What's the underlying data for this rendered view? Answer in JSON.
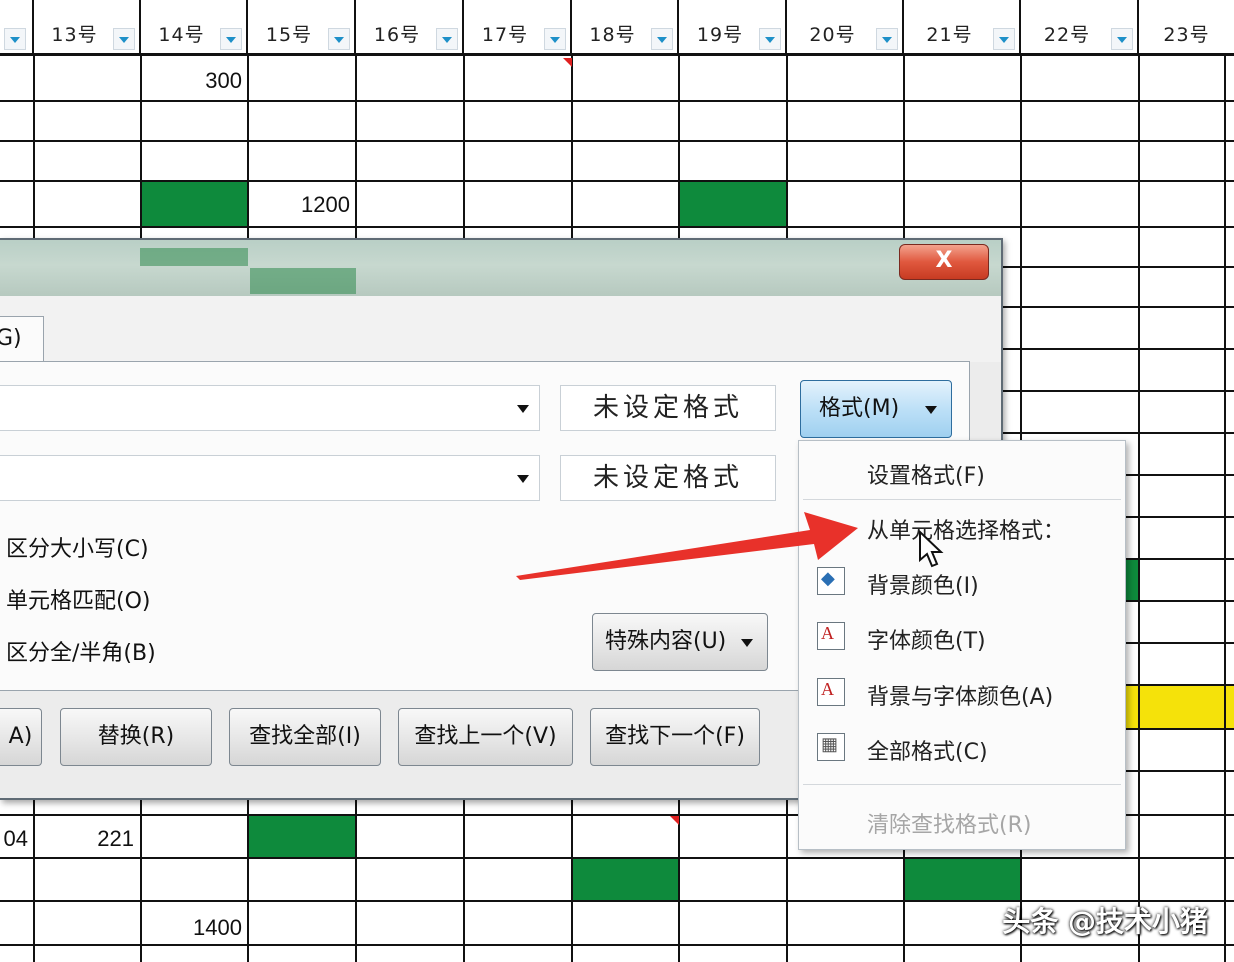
{
  "sheet": {
    "headers": [
      "",
      "13号",
      "14号",
      "15号",
      "16号",
      "17号",
      "18号",
      "19号",
      "20号",
      "21号",
      "22号",
      "23号"
    ],
    "cells": {
      "r1_14": "300",
      "r3_15": "1200",
      "r9_c0": "04",
      "r9_13": "221",
      "r11_14": "1400"
    },
    "colors": {
      "green": "#0e8a3c",
      "yellow": "#f5e20a",
      "red": "#e02020"
    }
  },
  "dialog": {
    "close_label": "X",
    "tab_label": "G)",
    "find_format_preview": "未设定格式",
    "replace_format_preview": "未设定格式",
    "format_button": "格式(M)",
    "options": [
      "区分大小写(C)",
      "单元格匹配(O)",
      "区分全/半角(B)"
    ],
    "special_button": "特殊内容(U)",
    "buttons": [
      "A)",
      "替换(R)",
      "查找全部(I)",
      "查找上一个(V)",
      "查找下一个(F)"
    ]
  },
  "menu": {
    "items": [
      {
        "label": "设置格式(F)",
        "icon": ""
      },
      {
        "label": "从单元格选择格式：",
        "icon": ""
      },
      {
        "label": "背景颜色(I)",
        "icon": "fill-color-icon"
      },
      {
        "label": "字体颜色(T)",
        "icon": "font-color-icon"
      },
      {
        "label": "背景与字体颜色(A)",
        "icon": "fill-font-color-icon"
      },
      {
        "label": "全部格式(C)",
        "icon": "all-format-icon"
      },
      {
        "label": "清除查找格式(R)",
        "icon": ""
      }
    ]
  },
  "watermark": "头条 @技术小猪"
}
